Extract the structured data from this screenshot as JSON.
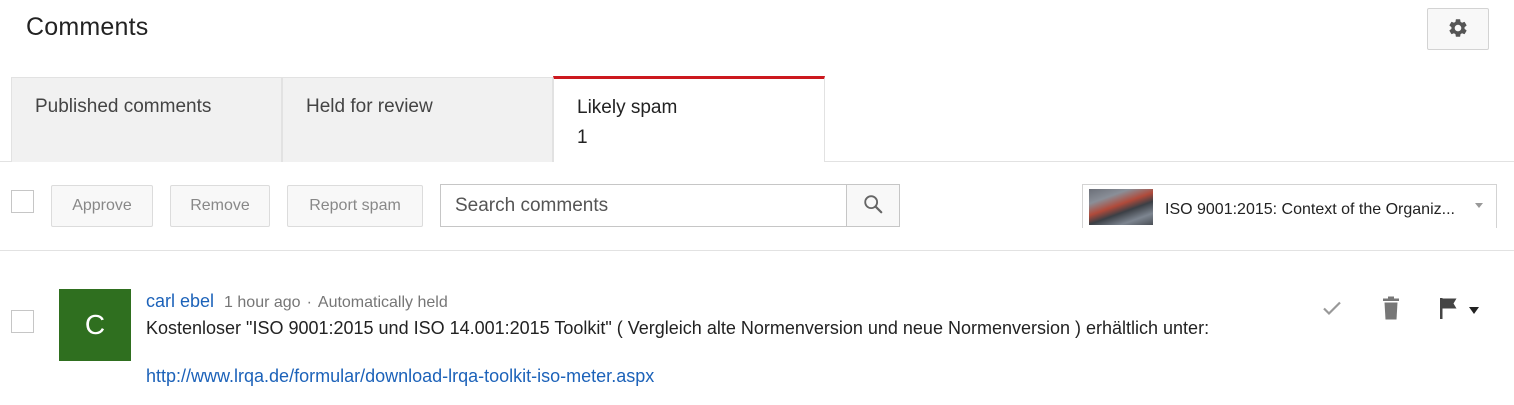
{
  "header": {
    "title": "Comments",
    "settings_icon": "gear-icon"
  },
  "tabs": [
    {
      "label": "Published comments",
      "count": ""
    },
    {
      "label": "Held for review",
      "count": ""
    },
    {
      "label": "Likely spam",
      "count": "1",
      "active": true
    }
  ],
  "colors": {
    "active_tab_accent": "#cc181e",
    "link": "#1c62b9",
    "avatar_bg": "#2f6f1f"
  },
  "toolbar": {
    "approve_label": "Approve",
    "remove_label": "Remove",
    "report_spam_label": "Report spam",
    "search_placeholder": "Search comments",
    "video_filter": {
      "selected_title": "ISO 9001:2015: Context of the Organiz..."
    }
  },
  "comments": [
    {
      "avatar_letter": "C",
      "author": "carl ebel",
      "time": "1 hour ago",
      "separator": "·",
      "status": "Automatically held",
      "text": "Kostenloser \"ISO 9001:2015 und ISO 14.001:2015 Toolkit\" ( Vergleich alte Normenversion und neue Normenversion ) erhältlich unter:",
      "link": "http://www.lrqa.de/formular/download-lrqa-toolkit-iso-meter.aspx",
      "actions": [
        "check-icon",
        "trash-icon",
        "flag-icon",
        "caret-down-icon"
      ]
    }
  ]
}
